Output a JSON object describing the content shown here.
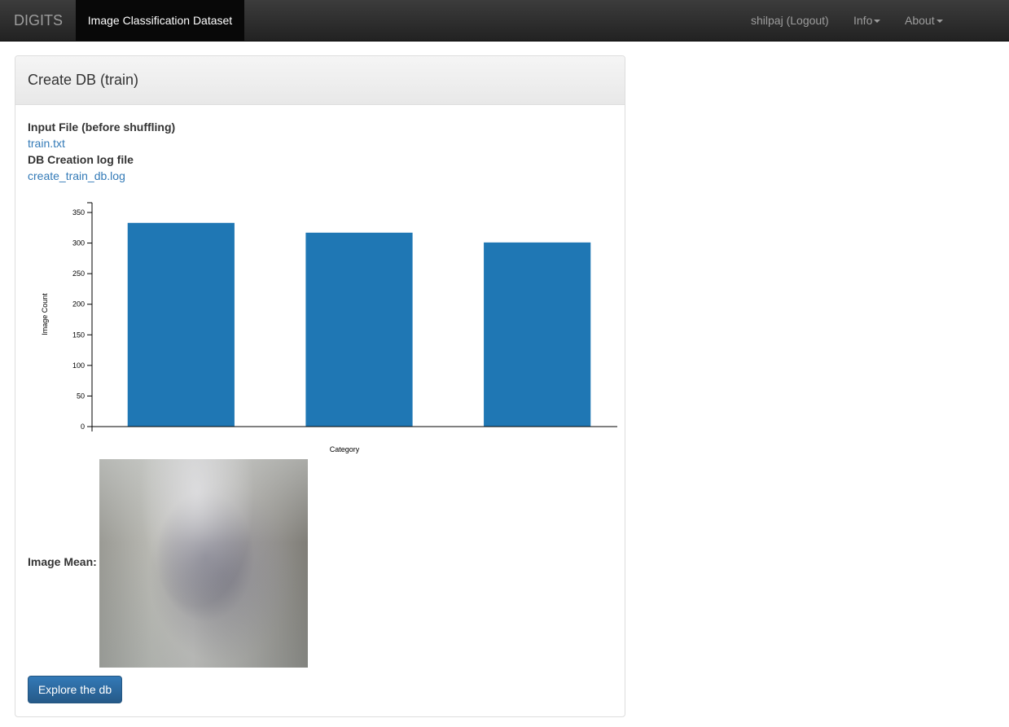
{
  "navbar": {
    "brand": "DIGITS",
    "active_page": "Image Classification Dataset",
    "user": "shilpaj (Logout)",
    "info_menu": "Info",
    "about_menu": "About"
  },
  "panel": {
    "title": "Create DB (train)",
    "input_file_label": "Input File (before shuffling)",
    "input_file_link": "train.txt",
    "log_label": "DB Creation log file",
    "log_link": "create_train_db.log",
    "image_mean_label": "Image Mean:",
    "explore_button": "Explore the db"
  },
  "chart_data": {
    "type": "bar",
    "categories": [
      "",
      "",
      ""
    ],
    "values": [
      333,
      317,
      301
    ],
    "title": "",
    "xlabel": "Category",
    "ylabel": "Image Count",
    "ylim": [
      0,
      350
    ],
    "yticks": [
      0,
      50,
      100,
      150,
      200,
      250,
      300,
      350
    ],
    "bar_color": "#1f77b4",
    "grid": false,
    "legend": "none"
  },
  "colors": {
    "navbar": "#222222",
    "link": "#337ab7",
    "button": "#337ab7"
  }
}
